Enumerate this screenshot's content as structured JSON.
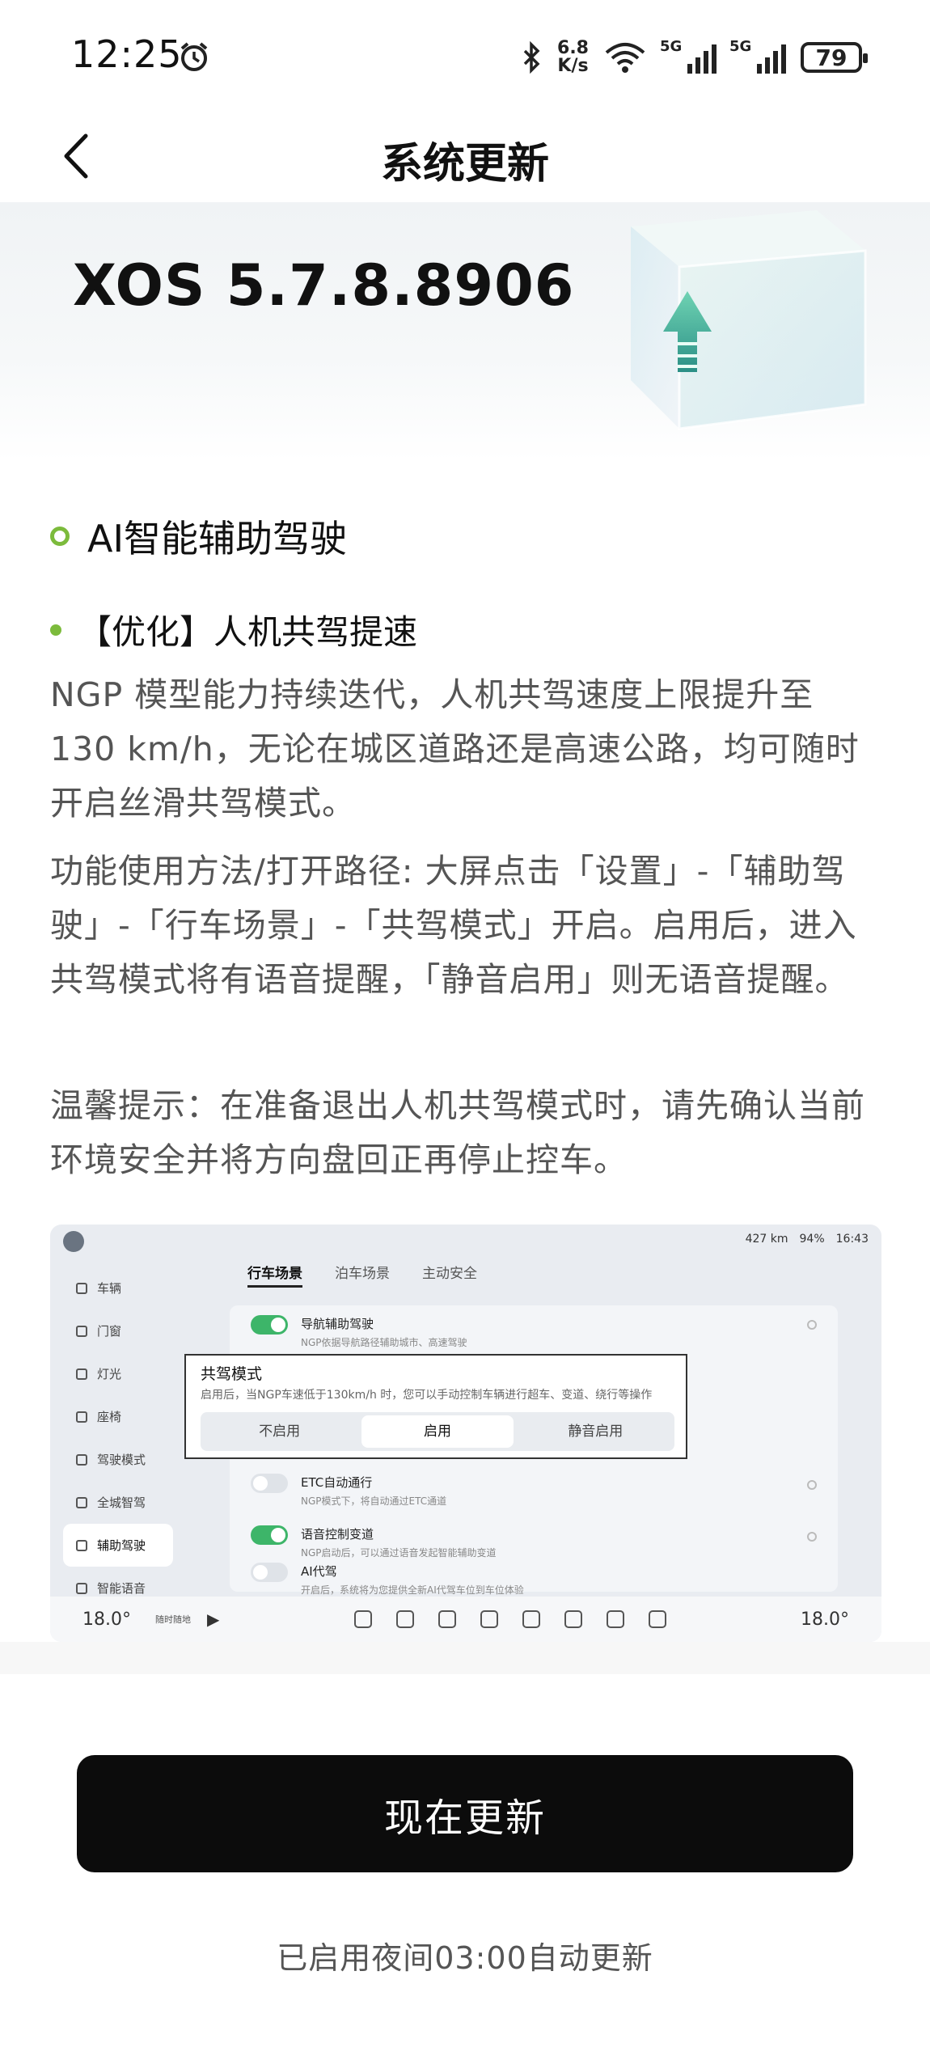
{
  "status_bar": {
    "time": "12:25",
    "net_speed_value": "6.8",
    "net_speed_unit": "K/s",
    "signal1_label": "5G",
    "signal2_label": "5G",
    "battery": "79"
  },
  "header": {
    "title": "系统更新"
  },
  "hero": {
    "version": "XOS 5.7.8.8906"
  },
  "section": {
    "title": "AI智能辅助驾驶",
    "item_title": "【优化】人机共驾提速",
    "paragraphs": [
      "NGP 模型能力持续迭代，人机共驾速度上限提升至 130 km/h，无论在城区道路还是高速公路，均可随时开启丝滑共驾模式。",
      "功能使用方法/打开路径: 大屏点击「设置」-「辅助驾驶」-「行车场景」-「共驾模式」开启。启用后，进入共驾模式将有语音提醒，「静音启用」则无语音提醒。",
      "温馨提示：在准备退出人机共驾模式时，请先确认当前环境安全并将方向盘回正再停止控车。"
    ]
  },
  "car_screen": {
    "status": {
      "range": "427 km",
      "battery": "94%",
      "time": "16:43"
    },
    "sidebar": [
      "车辆",
      "门窗",
      "灯光",
      "座椅",
      "驾驶模式",
      "全城智驾",
      "辅助驾驶",
      "智能语音"
    ],
    "tabs": [
      "行车场景",
      "泊车场景",
      "主动安全"
    ],
    "rows": [
      {
        "title": "导航辅助驾驶",
        "sub": "NGP依据导航路径辅助城市、高速驾驶"
      },
      {
        "title": "ETC自动通行",
        "sub": "NGP模式下，将自动通过ETC通道"
      },
      {
        "title": "语音控制变道",
        "sub": "NGP启动后，可以通过语音发起智能辅助变道"
      },
      {
        "title": "AI代驾",
        "sub": "开启后，系统将为您提供全新AI代驾车位到车位体验"
      }
    ],
    "coop": {
      "title": "共驾模式",
      "sub": "启用后，当NGP车速低于130km/h 时，您可以手动控制车辆进行超车、变道、绕行等操作",
      "options": [
        "不启用",
        "启用",
        "静音启用"
      ],
      "selected": "启用"
    },
    "bottom": {
      "temp_left": "18.0°",
      "music": "随时随地",
      "temp_right": "18.0°"
    }
  },
  "actions": {
    "update_label": "现在更新"
  },
  "footer": {
    "auto_update_note": "已启用夜间03:00自动更新"
  },
  "colors": {
    "accent": "#7cbb3c",
    "button_bg": "#0c0c0c",
    "toggle_on": "#3db569"
  }
}
